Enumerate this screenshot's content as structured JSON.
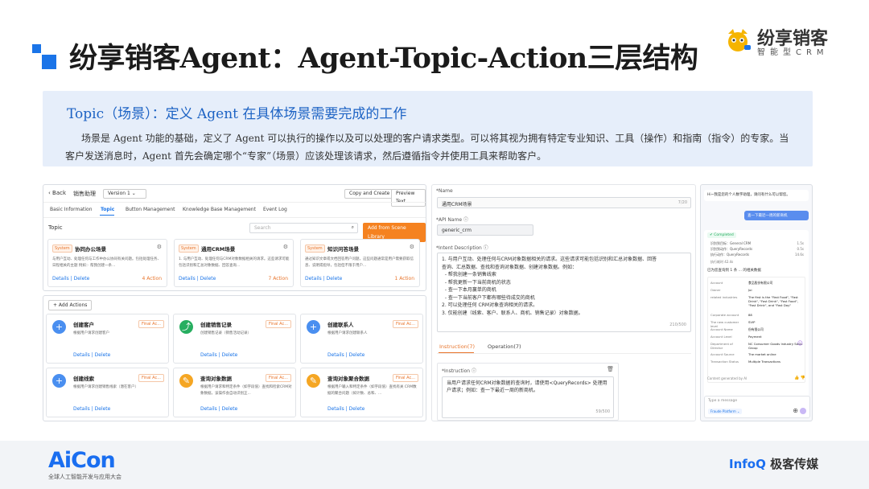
{
  "header": {
    "title": "纷享销客Agent：Agent-Topic-Action三层结构",
    "brand_name": "纷享销客",
    "brand_sub": "智能型CRM"
  },
  "intro": {
    "heading": "Topic（场景）：定义 Agent 在具体场景需要完成的工作",
    "body": "场景是 Agent 功能的基础，定义了 Agent 可以执行的操作以及可以处理的客户请求类型。可以将其视为拥有特定专业知识、工具（操作）和指南（指令）的专家。当客户发送消息时，Agent 首先会确定哪个“专家”（场景）应该处理该请求，然后遵循指令并使用工具来帮助客户。"
  },
  "topic_panel": {
    "back": "‹ Back",
    "crumb": "销售助理",
    "version": "Version 1",
    "copy_btn": "Copy and Create",
    "preview_btn": "Preview Text",
    "tabs": [
      "Basic Information",
      "Topic",
      "Button Management",
      "Knowledge Base Management",
      "Event Log"
    ],
    "topic_label": "Topic",
    "search_placeholder": "Search",
    "add_btn": "Add from Scene Library",
    "cards": [
      {
        "tag": "System",
        "name": "协同办公场景",
        "desc": "与用户互动、处理任何与工作中办公协同有关问题。包括处理任务、日程相关的主题 例如：· 帮我创建一条...",
        "links": "Details | Delete",
        "count": "4 Action"
      },
      {
        "tag": "System",
        "name": "通用CRM场景",
        "desc": "1. 与用户互动、处理任何与CRM对象数据相关的请求。这些请求可能包括识别和汇总对象数据、回答查询...",
        "links": "Details | Delete",
        "count": "7 Action"
      },
      {
        "tag": "System",
        "name": "知识问答场景",
        "desc": "通过知识文章或文档回答用户问题，这些问题通常是用户需要获取信息、说明或指导，包括但不限于用户...",
        "links": "Details | Delete",
        "count": "1 Action"
      }
    ]
  },
  "actions_panel": {
    "add_btn": "+ Add Actions",
    "actions": [
      {
        "name": "创建客户",
        "tag": "Final Ac...",
        "desc": "根据用户请求创建客户",
        "links": "Details | Delete",
        "icon": "plus-icon",
        "color": "#4a8ff0"
      },
      {
        "name": "创建销售记录",
        "tag": "Final Ac...",
        "desc": "创建销售记录（销售活动记录）",
        "links": "Details | Delete",
        "icon": "chart-icon",
        "color": "#27ae60"
      },
      {
        "name": "创建联系人",
        "tag": "Final Ac...",
        "desc": "根据用户请求创建联系人",
        "links": "Details | Delete",
        "icon": "plus-icon",
        "color": "#4a8ff0"
      },
      {
        "name": "创建线索",
        "tag": "Final Ac...",
        "desc": "根据用户请求创建销售线索（潜在客户）",
        "links": "Details | Delete",
        "icon": "plus-icon",
        "color": "#4a8ff0"
      },
      {
        "name": "查询对象数据",
        "tag": "Final Ac...",
        "desc": "根据用户请求和特定条件（如字段值）查找和检索CRM对象数据，该操作会自动识别正...",
        "links": "Details | Delete",
        "icon": "edit-icon",
        "color": "#f5a623"
      },
      {
        "name": "查询对象聚合数据",
        "tag": "Final Ac...",
        "desc": "根据用户输入和特定条件（如字段值）查找有关 CRM数据的聚合问题（如计数、总和、...",
        "links": "Details | Delete",
        "icon": "edit-icon",
        "color": "#f5a623"
      }
    ]
  },
  "form_panel": {
    "name_label": "*Name",
    "name_value": "通用CRM场景",
    "name_count": "7/20",
    "api_label": "*API Name ⓘ",
    "api_value": "generic_crm",
    "intent_label": "*Intent Description ⓘ",
    "intent_lines": [
      "1. 与用户互动、处理任何与CRM对象数据相关的请求。这些请求可能包括识别和汇总对象数据、回答",
      "查询、汇总数据、查找和查询对象数据、创建对象数据。例如：",
      "  - 帮我创建一条销售线索",
      "  - 帮我更新一下当前商机的状态",
      "  - 查一下本月赢单的商机",
      "  - 查一下当前客户下都有哪些待成交的商机",
      "2. 可以处理任何 CRM对象查询相关的请求。",
      "3. 仅能创建（线索、客户、联系人、商机、销售记录）对象数据。"
    ],
    "intent_count": "210/500",
    "tab_instruction": "Instruction(7)",
    "tab_operation": "Operation(7)",
    "instr_label": "*Instruction ⓘ",
    "instr_text": "当用户请求任何CRM对象数据的查询时，请使用<QueryRecords> 处理用户请求；例如：查一下最近一周的新商机。",
    "instr_count": "59/500"
  },
  "chat_panel": {
    "greeting": "Hi~我是您的个人数字助理，请问有什么可以帮您。",
    "user_msg": "查一下最近一周的新商机",
    "completed": "Completed",
    "steps": [
      "识别到目标：General CRM",
      "识别到动作：QueryRecords",
      "执行动作：QueryRecords"
    ],
    "step_times": [
      "1.5s",
      "0.5s",
      "14.6s"
    ],
    "total": "执行耗时 42.4s",
    "result_head": "已为您查询到 1 条 ... 的相关数据",
    "fields": [
      {
        "k": "Account",
        "v": "食品股份有限公司"
      },
      {
        "k": "Owner",
        "v": "Joi"
      },
      {
        "k": "related industries",
        "v": "The first is the \"Fast Food\", \"Fast Drink\", \"Fast Drink\", \"Fast Food\", \"Fast Drink\", and \"Fast Day\""
      },
      {
        "k": "Corporate account",
        "v": "88"
      },
      {
        "k": "The new customer level",
        "v": "SVIP"
      },
      {
        "k": "Account Name",
        "v": "份有限公司"
      },
      {
        "k": "Account Level",
        "v": "Payment"
      },
      {
        "k": "Department of Director",
        "v": "NC Consumer Goods Industry Sales Group"
      },
      {
        "k": "Account Source",
        "v": "The market online"
      },
      {
        "k": "Transaction Status",
        "v": "Multiple Transactions"
      }
    ],
    "ai_note": "Content generated by AI",
    "input_placeholder": "Type a message",
    "platform": "Fraude Platform"
  },
  "footer": {
    "aicon": "AiCon",
    "aicon_sub": "全球人工智能开发与应用大会",
    "infoq_a": "InfoQ",
    "infoq_b": "极客传媒"
  }
}
